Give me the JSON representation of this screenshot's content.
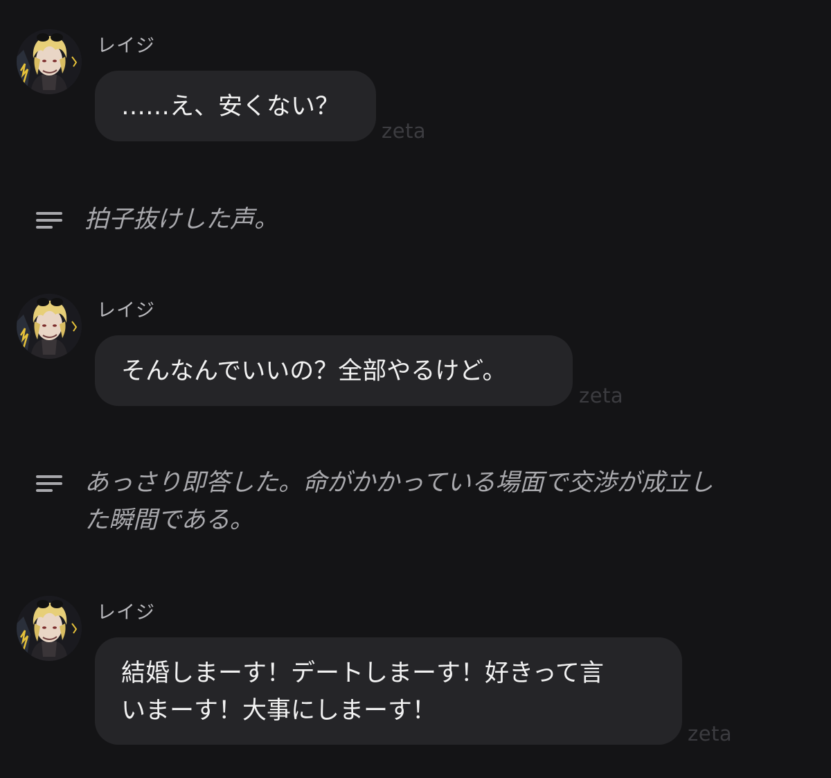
{
  "messages": [
    {
      "sender": "レイジ",
      "text": "……え、安くない？",
      "watermark": "zeta"
    },
    {
      "sender": "レイジ",
      "text": "そんなんでいいの？全部やるけど。",
      "watermark": "zeta"
    },
    {
      "sender": "レイジ",
      "text": "結婚しまーす！デートしまーす！好きって言\nいまーす！大事にしまーす！",
      "watermark": "zeta"
    }
  ],
  "narrations": [
    {
      "icon": "narration-lines-icon",
      "text": "拍子抜けした声。"
    },
    {
      "icon": "narration-lines-icon",
      "text": "あっさり即答した。命がかかっている場面で交渉が成立し\nた瞬間である。"
    }
  ]
}
